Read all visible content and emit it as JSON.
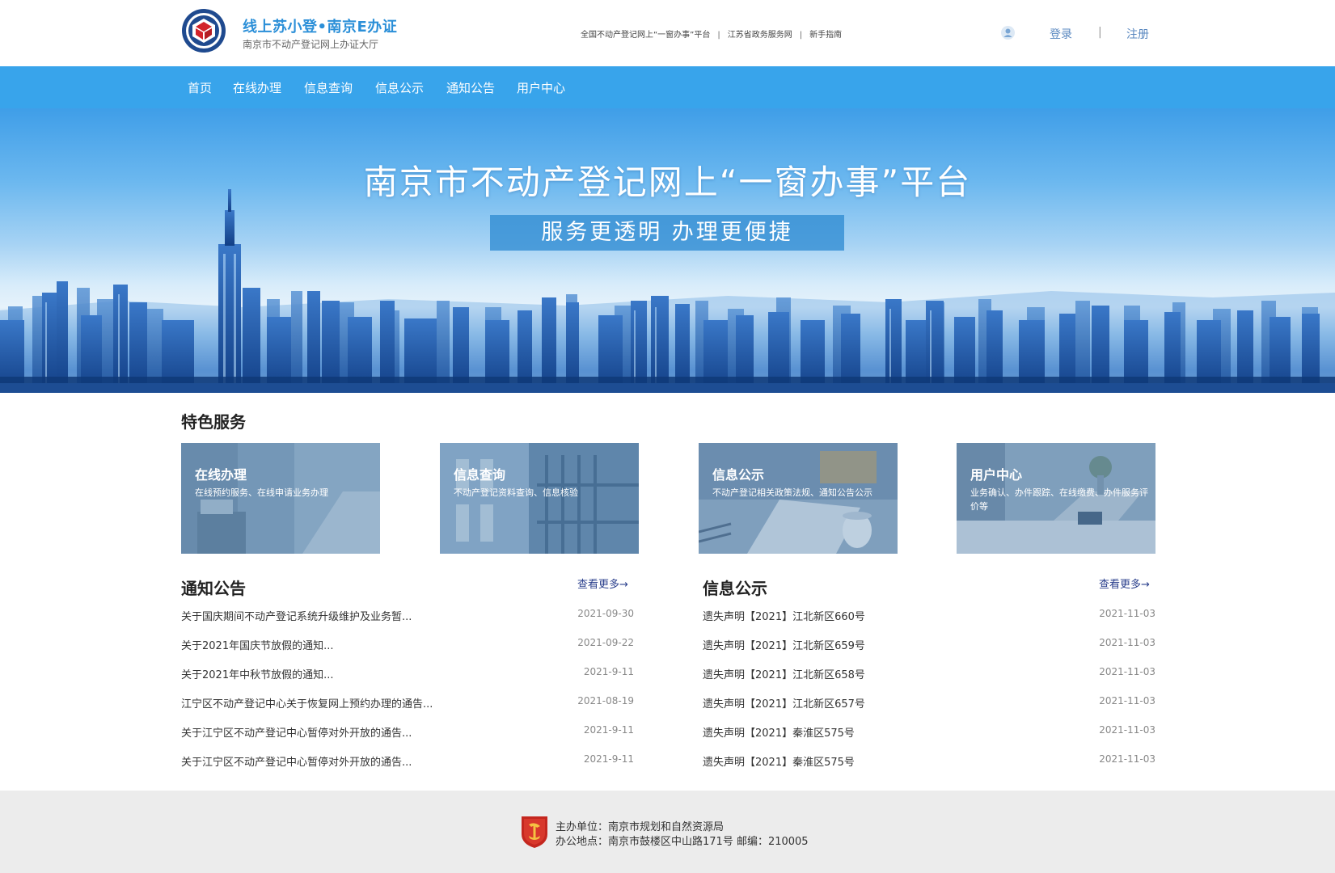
{
  "header": {
    "logo_name": "bureau-seal-logo",
    "brand_title": "线上苏小登•南京E办证",
    "brand_subtitle": "南京市不动产登记网上办证大厅",
    "top_links": [
      {
        "label": "全国不动产登记网上“一窗办事”平台"
      },
      {
        "label": "江苏省政务服务网"
      },
      {
        "label": "新手指南"
      }
    ],
    "login": "登录",
    "separator": "|",
    "register": "注册"
  },
  "nav": {
    "items": [
      {
        "label": "首页"
      },
      {
        "label": "在线办理"
      },
      {
        "label": "信息查询"
      },
      {
        "label": "信息公示"
      },
      {
        "label": "通知公告"
      },
      {
        "label": "用户中心"
      }
    ]
  },
  "banner": {
    "title": "南京市不动产登记网上“一窗办事”平台",
    "tagline": "服务更透明    办理更便捷"
  },
  "features": {
    "title": "特色服务",
    "cards": [
      {
        "title": "在线办理",
        "desc": "在线预约服务、在线申请业务办理"
      },
      {
        "title": "信息查询",
        "desc": "不动产登记资料查询、信息核验"
      },
      {
        "title": "信息公示",
        "desc": "不动产登记相关政策法规、通知公告公示"
      },
      {
        "title": "用户中心",
        "desc": "业务确认、办件跟踪、在线缴费、办件服务评价等"
      }
    ]
  },
  "notices": {
    "title": "通知公告",
    "more": "查看更多→",
    "items": [
      {
        "title": "关于国庆期间不动产登记系统升级维护及业务暂...",
        "date": "2021-09-30"
      },
      {
        "title": "关于2021年国庆节放假的通知...",
        "date": "2021-09-22"
      },
      {
        "title": "关于2021年中秋节放假的通知...",
        "date": "2021-9-11"
      },
      {
        "title": "江宁区不动产登记中心关于恢复网上预约办理的通告...",
        "date": "2021-08-19"
      },
      {
        "title": "关于江宁区不动产登记中心暂停对外开放的通告...",
        "date": "2021-9-11"
      },
      {
        "title": "关于江宁区不动产登记中心暂停对外开放的通告...",
        "date": "2021-9-11"
      }
    ]
  },
  "publicity": {
    "title": "信息公示",
    "more": "查看更多→",
    "items": [
      {
        "title": "遗失声明【2021】江北新区660号",
        "date": "2021-11-03"
      },
      {
        "title": "遗失声明【2021】江北新区659号",
        "date": "2021-11-03"
      },
      {
        "title": "遗失声明【2021】江北新区658号",
        "date": "2021-11-03"
      },
      {
        "title": "遗失声明【2021】江北新区657号",
        "date": "2021-11-03"
      },
      {
        "title": "遗失声明【2021】秦淮区575号",
        "date": "2021-11-03"
      },
      {
        "title": "遗失声明【2021】秦淮区575号",
        "date": "2021-11-03"
      }
    ]
  },
  "footer": {
    "host": "主办单位：南京市规划和自然资源局",
    "address": "办公地点：南京市鼓楼区中山路171号 邮编：210005"
  },
  "colors": {
    "nav_bg": "#38a4eb",
    "brand_blue": "#2b8fd8",
    "link_dark_blue": "#2a3f8c",
    "footer_bg": "#ececec"
  }
}
